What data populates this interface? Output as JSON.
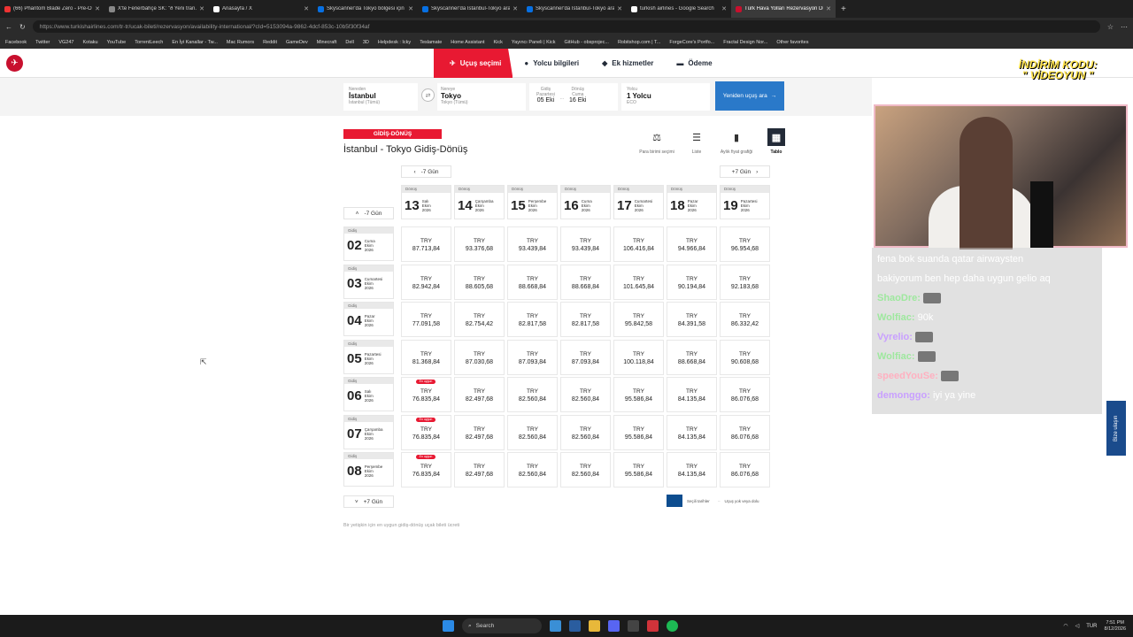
{
  "tabs": [
    {
      "title": "(66) Phantom Blade Zero - Pre-Or...",
      "color": "#e33"
    },
    {
      "title": "X'te Fenerbahçe SK: \"ð Yeni tran...",
      "color": "#888"
    },
    {
      "title": "Anasayfa / X",
      "color": "#fff"
    },
    {
      "title": "Skyscanner'da Tokyo bölgesi için ...",
      "color": "#0770e3"
    },
    {
      "title": "Skyscanner'da İstanbul-Tokyo ara...",
      "color": "#0770e3"
    },
    {
      "title": "Skyscanner'da İstanbul-Tokyo ara...",
      "color": "#0770e3"
    },
    {
      "title": "turkish airlines - Google Search",
      "color": "#fff"
    },
    {
      "title": "Türk Hava Yolları Rezervasyon Dur...",
      "color": "#c8102e",
      "active": true
    }
  ],
  "url": "https://www.turkishairlines.com/tr-tr/ucak-bileti/rezervasyon/availability-international/?cId=5153094a-9862-4dcf-853c-10b5f30f34af",
  "bookmarks": [
    "Facebook",
    "Twitter",
    "VG247",
    "Kotaku",
    "YouTube",
    "TorrentLeech",
    "En İyi Kanallar - Tw...",
    "Mac Rumors",
    "Reddit",
    "GameDev",
    "Minecraft",
    "Dell",
    "3D",
    "Helpdesk : Icky",
    "Teslamate",
    "Home Assistant",
    "Kick",
    "Yayıncı Paneli | Kick",
    "GitHub - obsprojec...",
    "Robitshop.com | T...",
    "ForgeCore's Portfo...",
    "Fractal Design Nor...",
    "Other favorites"
  ],
  "steps": [
    {
      "label": "Uçuş seçimi",
      "icon": "plane-icon"
    },
    {
      "label": "Yolcu bilgileri",
      "icon": "person-icon"
    },
    {
      "label": "Ek hizmetler",
      "icon": "extras-icon"
    },
    {
      "label": "Ödeme",
      "icon": "card-icon"
    }
  ],
  "promo": {
    "line1": "İNDİRİM KODU:",
    "line2": "\" VİDEOYUN \""
  },
  "search": {
    "from_label": "Nereden",
    "from_city": "İstanbul",
    "from_sub": "İstanbul (Tümü)",
    "to_label": "Nereye",
    "to_city": "Tokyo",
    "to_sub": "Tokyo (Tümü)",
    "dep_label": "Gidiş",
    "dep_day": "Pazartesi",
    "dep_date": "05 Eki",
    "ret_label": "Dönüş",
    "ret_day": "Cuma",
    "ret_date": "16 Eki",
    "pax_label": "Yolcu",
    "pax": "1 Yolcu",
    "cabin": "ECO",
    "button": "Yeniden uçuş ara"
  },
  "badge": "GİDİŞ-DÖNÜŞ",
  "route_title": "İstanbul - Tokyo Gidiş-Dönüş",
  "views": [
    {
      "label": "Para birimi seçimi",
      "icon": "currency-icon"
    },
    {
      "label": "Liste",
      "icon": "list-icon"
    },
    {
      "label": "Aylık fiyat grafiği",
      "icon": "bar-chart-icon"
    },
    {
      "label": "Tablo",
      "icon": "calendar-icon",
      "selected": true
    }
  ],
  "nav": {
    "prev_top": "-7 Gün",
    "next_top": "+7 Gün",
    "prev_rows": "-7 Gün",
    "next_rows": "+7 Gün"
  },
  "returns": [
    {
      "num": "13",
      "day": "Salı",
      "month": "Ekim",
      "year": "2026"
    },
    {
      "num": "14",
      "day": "Çarşamba",
      "month": "Ekim",
      "year": "2026"
    },
    {
      "num": "15",
      "day": "Perşembe",
      "month": "Ekim",
      "year": "2026"
    },
    {
      "num": "16",
      "day": "Cuma",
      "month": "Ekim",
      "year": "2026"
    },
    {
      "num": "17",
      "day": "Cumartesi",
      "month": "Ekim",
      "year": "2026"
    },
    {
      "num": "18",
      "day": "Pazar",
      "month": "Ekim",
      "year": "2026"
    },
    {
      "num": "19",
      "day": "Pazartesi",
      "month": "Ekim",
      "year": "2026"
    }
  ],
  "return_label": "Dönüş",
  "depart_label": "Gidiş",
  "currency": "TRY",
  "best_label": "En uygun",
  "departures": [
    {
      "num": "02",
      "day": "Cuma",
      "month": "Ekim",
      "year": "2026",
      "prices": [
        "87.713,84",
        "93.376,68",
        "93.439,84",
        "93.439,84",
        "106.416,84",
        "94.966,84",
        "96.954,68"
      ]
    },
    {
      "num": "03",
      "day": "Cumartesi",
      "month": "Ekim",
      "year": "2026",
      "prices": [
        "82.942,84",
        "88.605,68",
        "88.668,84",
        "88.668,84",
        "101.645,84",
        "90.194,84",
        "92.183,68"
      ]
    },
    {
      "num": "04",
      "day": "Pazar",
      "month": "Ekim",
      "year": "2026",
      "prices": [
        "77.091,58",
        "82.754,42",
        "82.817,58",
        "82.817,58",
        "95.842,58",
        "84.391,58",
        "86.332,42"
      ]
    },
    {
      "num": "05",
      "day": "Pazartesi",
      "month": "Ekim",
      "year": "2026",
      "prices": [
        "81.368,84",
        "87.030,68",
        "87.093,84",
        "87.093,84",
        "100.118,84",
        "88.668,84",
        "90.608,68"
      ]
    },
    {
      "num": "06",
      "day": "Salı",
      "month": "Ekim",
      "year": "2026",
      "best": true,
      "prices": [
        "76.835,84",
        "82.497,68",
        "82.560,84",
        "82.560,84",
        "95.586,84",
        "84.135,84",
        "86.076,68"
      ]
    },
    {
      "num": "07",
      "day": "Çarşamba",
      "month": "Ekim",
      "year": "2026",
      "best": true,
      "prices": [
        "76.835,84",
        "82.497,68",
        "82.560,84",
        "82.560,84",
        "95.586,84",
        "84.135,84",
        "86.076,68"
      ]
    },
    {
      "num": "08",
      "day": "Perşembe",
      "month": "Ekim",
      "year": "2026",
      "best": true,
      "prices": [
        "76.835,84",
        "82.497,68",
        "82.560,84",
        "82.560,84",
        "95.586,84",
        "84.135,84",
        "86.076,68"
      ]
    }
  ],
  "legend": {
    "selected": "Seçili tarihler",
    "none": "Uçuş yok veya dolu"
  },
  "note": "Bir yetişkin için en uygun gidiş-dönüş uçak bileti ücreti",
  "chat": [
    {
      "user": "",
      "text": "fena bok suanda qatar airwaysten",
      "color": "#fff"
    },
    {
      "user": "",
      "text": "bakiyorum ben hep daha uygun gelio aq",
      "color": "#fff"
    },
    {
      "user": "ShaoDre:",
      "text": "",
      "emote": true,
      "color": "#9ee89e"
    },
    {
      "user": "Wolfiac:",
      "text": "90k",
      "color": "#9ee89e"
    },
    {
      "user": "Vyrelio:",
      "text": "",
      "emote": true,
      "color": "#c9a0ff"
    },
    {
      "user": "Wolfiac:",
      "text": "",
      "emote": true,
      "color": "#9ee89e"
    },
    {
      "user": "speedYouSe:",
      "text": "",
      "emote": true,
      "color": "#ffb0c0"
    },
    {
      "user": "demonggo:",
      "text": "iyi ya yine",
      "color": "#c9a0ff"
    }
  ],
  "side_tab": "Bize ulaşın",
  "taskbar": {
    "search": "Search",
    "lang": "TUR",
    "time": "7:51 PM",
    "date": "8/12/2026"
  }
}
